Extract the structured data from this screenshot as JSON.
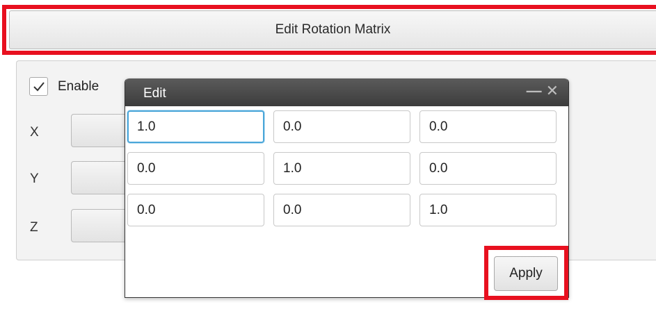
{
  "top_button": {
    "label": "Edit Rotation Matrix"
  },
  "panel": {
    "enable": {
      "label": "Enable",
      "checked": true
    },
    "axes": [
      {
        "label": "X"
      },
      {
        "label": "Y"
      },
      {
        "label": "Z"
      }
    ]
  },
  "dialog": {
    "title": "Edit",
    "controls": {
      "minimize": "—",
      "close": "✕"
    },
    "matrix": [
      [
        "1.0",
        "0.0",
        "0.0"
      ],
      [
        "0.0",
        "1.0",
        "0.0"
      ],
      [
        "0.0",
        "0.0",
        "1.0"
      ]
    ],
    "apply_label": "Apply"
  },
  "colors": {
    "highlight": "#e8101f",
    "focus": "#4aa6d9",
    "titlebar": "#444444"
  }
}
